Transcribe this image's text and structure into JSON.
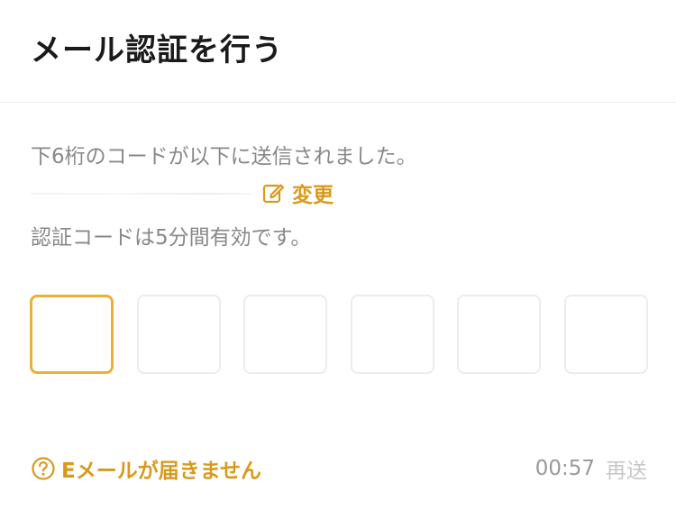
{
  "header": {
    "title": "メール認証を行う"
  },
  "message": {
    "line1": "下6桁のコードが以下に送信されました。",
    "change_label": "変更",
    "line3": "認証コードは5分間有効です。"
  },
  "otp": {
    "length": 6,
    "active_index": 0
  },
  "footer": {
    "help_label": "Eメールが届きません",
    "timer": "00:57",
    "resend_label": "再送"
  },
  "colors": {
    "accent": "#d89a1d",
    "active_border": "#e8b13a",
    "muted_text": "#888888",
    "disabled_text": "#c8c8c8"
  },
  "icons": {
    "edit": "edit-icon",
    "help": "question-circle-icon"
  }
}
